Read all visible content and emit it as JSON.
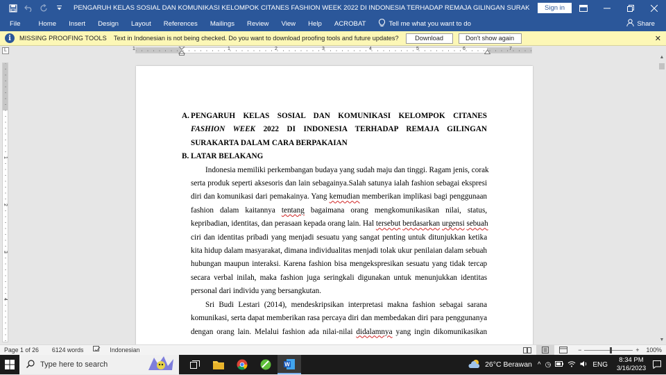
{
  "colors": {
    "word_blue": "#2b579a",
    "message_bar": "#fcf7b6",
    "squiggle": "#d02020"
  },
  "titlebar": {
    "title": "PENGARUH KELAS SOSIAL DAN KOMUNIKASI KELOMPOK CITANES FASHION WEEK 2022 DI INDONESIA TERHADAP REMAJA GILINGAN SURAKARTA DALAM CARA BERPAKAIAN.do...",
    "signin": "Sign in",
    "icons": [
      "save-icon",
      "undo-icon",
      "redo-icon",
      "customize-icon"
    ]
  },
  "ribbon": {
    "tabs": [
      "File",
      "Home",
      "Insert",
      "Design",
      "Layout",
      "References",
      "Mailings",
      "Review",
      "View",
      "Help",
      "ACROBAT"
    ],
    "tell_me": "Tell me what you want to do",
    "share": "Share"
  },
  "message_bar": {
    "title": "MISSING PROOFING TOOLS",
    "text": "Text in Indonesian is not being checked. Do you want to download proofing tools and future updates?",
    "download": "Download",
    "dont_show": "Don't show again"
  },
  "ruler": {
    "h_labels": [
      "1",
      "1",
      "2",
      "3",
      "4",
      "5",
      "6",
      "7"
    ],
    "v_labels": [
      "1",
      "2",
      "3",
      "4"
    ]
  },
  "document": {
    "heading_a_num": "A.",
    "heading_a_lines": [
      "PENGARUH KELAS SOSIAL DAN KOMUNIKASI KELOMPOK CITANES",
      "FASHION WEEK 2022 DI INDONESIA TERHADAP REMAJA GILINGAN",
      "SURAKARTA DALAM CARA BERPAKAIAN"
    ],
    "heading_a_italic": "FASHION WEEK",
    "heading_b_num": "B.",
    "heading_b": "LATAR BELAKANG",
    "para1": [
      "Indonesia memiliki perkembangan budaya yang sudah maju dan tinggi. Ragam jenis, corak",
      "serta produk seperti aksesoris dan lain sebagainya.Salah satunya ialah fashion sebagai ekspresi",
      "diri dan komunikasi dari pemakainya. Yang kemudian memberikan implikasi bagi penggunaan",
      "fashion dalam kaitannya tentang bagaimana orang mengkomunikasikan nilai, status,",
      "kepribadian, identitas, dan perasaan kepada orang lain. Hal tersebut berdasarkan urgensi sebuah",
      "ciri dan identitas pribadi yang menjadi sesuatu yang sangat penting untuk ditunjukkan ketika",
      "kita hidup dalam masyarakat, dimana individualitas menjadi tolak ukur penilaian dalam sebuah",
      "hubungan maupun interaksi. Karena fashion bisa mengekspresikan sesuatu yang tidak tercap",
      "secara verbal inilah, maka fashion juga seringkali digunakan untuk menunjukkan identitas",
      "personal dari individu yang bersangkutan."
    ],
    "para2": [
      "Sri Budi Lestari (2014), mendeskripsikan interpretasi makna fashion sebagai sarana",
      "komunikasi, serta dapat memberikan rasa percaya diri dan membedakan diri para penggunanya",
      "dengan orang lain. Melalui fashion ada nilai-nilai didalamnya yang ingin dikomunikasikan"
    ]
  },
  "status": {
    "page": "Page 1 of 26",
    "words": "6124 words",
    "language": "Indonesian",
    "zoom": "100%",
    "zoom_minus": "−",
    "zoom_plus": "+"
  },
  "taskbar": {
    "search_placeholder": "Type here to search",
    "weather": "26°C  Berawan",
    "ime": "ENG",
    "time": "8:34 PM",
    "date": "3/16/2023"
  }
}
